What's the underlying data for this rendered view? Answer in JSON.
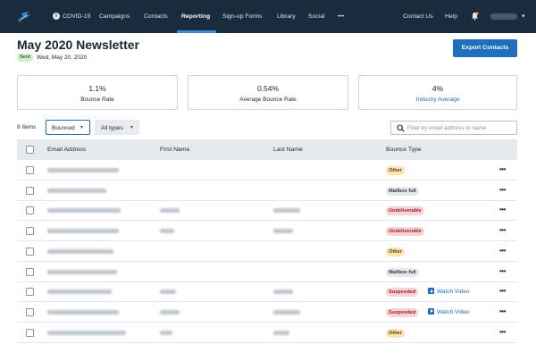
{
  "nav": {
    "items": [
      {
        "label": "COVID-19"
      },
      {
        "label": "Campaigns"
      },
      {
        "label": "Contacts"
      },
      {
        "label": "Reporting"
      },
      {
        "label": "Sign-up Forms"
      },
      {
        "label": "Library"
      },
      {
        "label": "Social"
      },
      {
        "label": "•••"
      },
      {
        "label": "Contact Us"
      },
      {
        "label": "Help"
      }
    ],
    "active": "Reporting",
    "bg_color": "#1b2b3e",
    "accent_color": "#3b8cd8"
  },
  "header": {
    "title": "May 2020 Newsletter",
    "status_badge": "Sent",
    "sent_date": "Wed, May 20, 2020",
    "export_label": "Export Contacts"
  },
  "stats": [
    {
      "value": "1.1%",
      "label": "Bounce Rate"
    },
    {
      "value": "0.54%",
      "label": "Average Bounce Rate"
    },
    {
      "value": "4%",
      "label": "Industry Average"
    }
  ],
  "filters": {
    "count_label": "9 Items",
    "bounced_select": "Bounced",
    "types_select": "All types",
    "search_placeholder": "Filter by email address or name"
  },
  "table": {
    "headers": {
      "email": "Email Address",
      "first": "First Name",
      "last": "Last Name",
      "bounce": "Bounce Type"
    },
    "rows": [
      {
        "bounce_type": "Other",
        "style": "other",
        "has_first": false,
        "has_last": false,
        "watch_video": ""
      },
      {
        "bounce_type": "Mailbox full",
        "style": "mailbox",
        "has_first": false,
        "has_last": false,
        "watch_video": ""
      },
      {
        "bounce_type": "Undeliverable",
        "style": "undeliv",
        "has_first": true,
        "has_last": true,
        "watch_video": ""
      },
      {
        "bounce_type": "Undeliverable",
        "style": "undeliv",
        "has_first": true,
        "has_last": true,
        "watch_video": ""
      },
      {
        "bounce_type": "Other",
        "style": "other",
        "has_first": false,
        "has_last": false,
        "watch_video": ""
      },
      {
        "bounce_type": "Mailbox full",
        "style": "mailbox",
        "has_first": false,
        "has_last": false,
        "watch_video": ""
      },
      {
        "bounce_type": "Suspended",
        "style": "susp",
        "has_first": true,
        "has_last": true,
        "watch_video": "Watch Video"
      },
      {
        "bounce_type": "Suspended",
        "style": "susp",
        "has_first": true,
        "has_last": true,
        "watch_video": "Watch Video"
      },
      {
        "bounce_type": "Other",
        "style": "other",
        "has_first": true,
        "has_last": true,
        "watch_video": ""
      }
    ]
  },
  "colors": {
    "primary_button": "#1e6fbd",
    "link": "#1e6fbd",
    "header_bg": "#e6e9ed",
    "sent_badge_bg": "#d4ecd2"
  }
}
